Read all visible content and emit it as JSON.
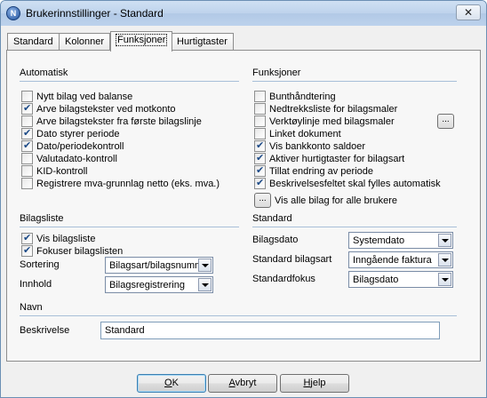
{
  "window": {
    "title": "Brukerinnstillinger - Standard",
    "close_glyph": "✕",
    "app_icon_letter": "N"
  },
  "tabs": [
    "Standard",
    "Kolonner",
    "Funksjoner",
    "Hurtigtaster"
  ],
  "automatisk": {
    "title": "Automatisk",
    "items": [
      {
        "label": "Nytt bilag ved balanse",
        "checked": false
      },
      {
        "label": "Arve bilagstekster ved motkonto",
        "checked": true
      },
      {
        "label": "Arve bilagstekster fra første bilagslinje",
        "checked": false
      },
      {
        "label": "Dato styrer periode",
        "checked": true
      },
      {
        "label": "Dato/periodekontroll",
        "checked": true
      },
      {
        "label": "Valutadato-kontroll",
        "checked": false
      },
      {
        "label": "KID-kontroll",
        "checked": false
      },
      {
        "label": "Registrere mva-grunnlag netto (eks. mva.)",
        "checked": false
      }
    ]
  },
  "funksjoner": {
    "title": "Funksjoner",
    "items": [
      {
        "label": "Bunthåndtering",
        "checked": false
      },
      {
        "label": "Nedtrekksliste for bilagsmaler",
        "checked": false
      },
      {
        "label": "Verktøylinje med bilagsmaler",
        "checked": false
      },
      {
        "label": "Linket dokument",
        "checked": false
      },
      {
        "label": "Vis bankkonto saldoer",
        "checked": true
      },
      {
        "label": "Aktiver hurtigtaster for bilagsart",
        "checked": true
      },
      {
        "label": "Tillat endring av periode",
        "checked": true
      },
      {
        "label": "Beskrivelsesfeltet skal fylles automatisk",
        "checked": true
      }
    ],
    "ellipsis_glyph": "...",
    "vis_alle_label": "Vis alle bilag for alle brukere"
  },
  "bilagsliste": {
    "title": "Bilagsliste",
    "items": [
      {
        "label": "Vis bilagsliste",
        "checked": true
      },
      {
        "label": "Fokuser bilagslisten",
        "checked": true
      }
    ],
    "sortering_label": "Sortering",
    "sortering_value": "Bilagsart/bilagsnummer",
    "innhold_label": "Innhold",
    "innhold_value": "Bilagsregistrering"
  },
  "standard": {
    "title": "Standard",
    "bilagsdato_label": "Bilagsdato",
    "bilagsdato_value": "Systemdato",
    "bilagsart_label": "Standard bilagsart",
    "bilagsart_value": "Inngående faktura",
    "fokus_label": "Standardfokus",
    "fokus_value": "Bilagsdato"
  },
  "navn": {
    "title": "Navn",
    "beskrivelse_label": "Beskrivelse",
    "beskrivelse_value": "Standard"
  },
  "buttons": {
    "ok_mnemonic": "O",
    "ok_rest": "K",
    "avbryt_mnemonic": "A",
    "avbryt_rest": "vbryt",
    "hjelp_mnemonic": "H",
    "hjelp_rest": "jelp"
  }
}
